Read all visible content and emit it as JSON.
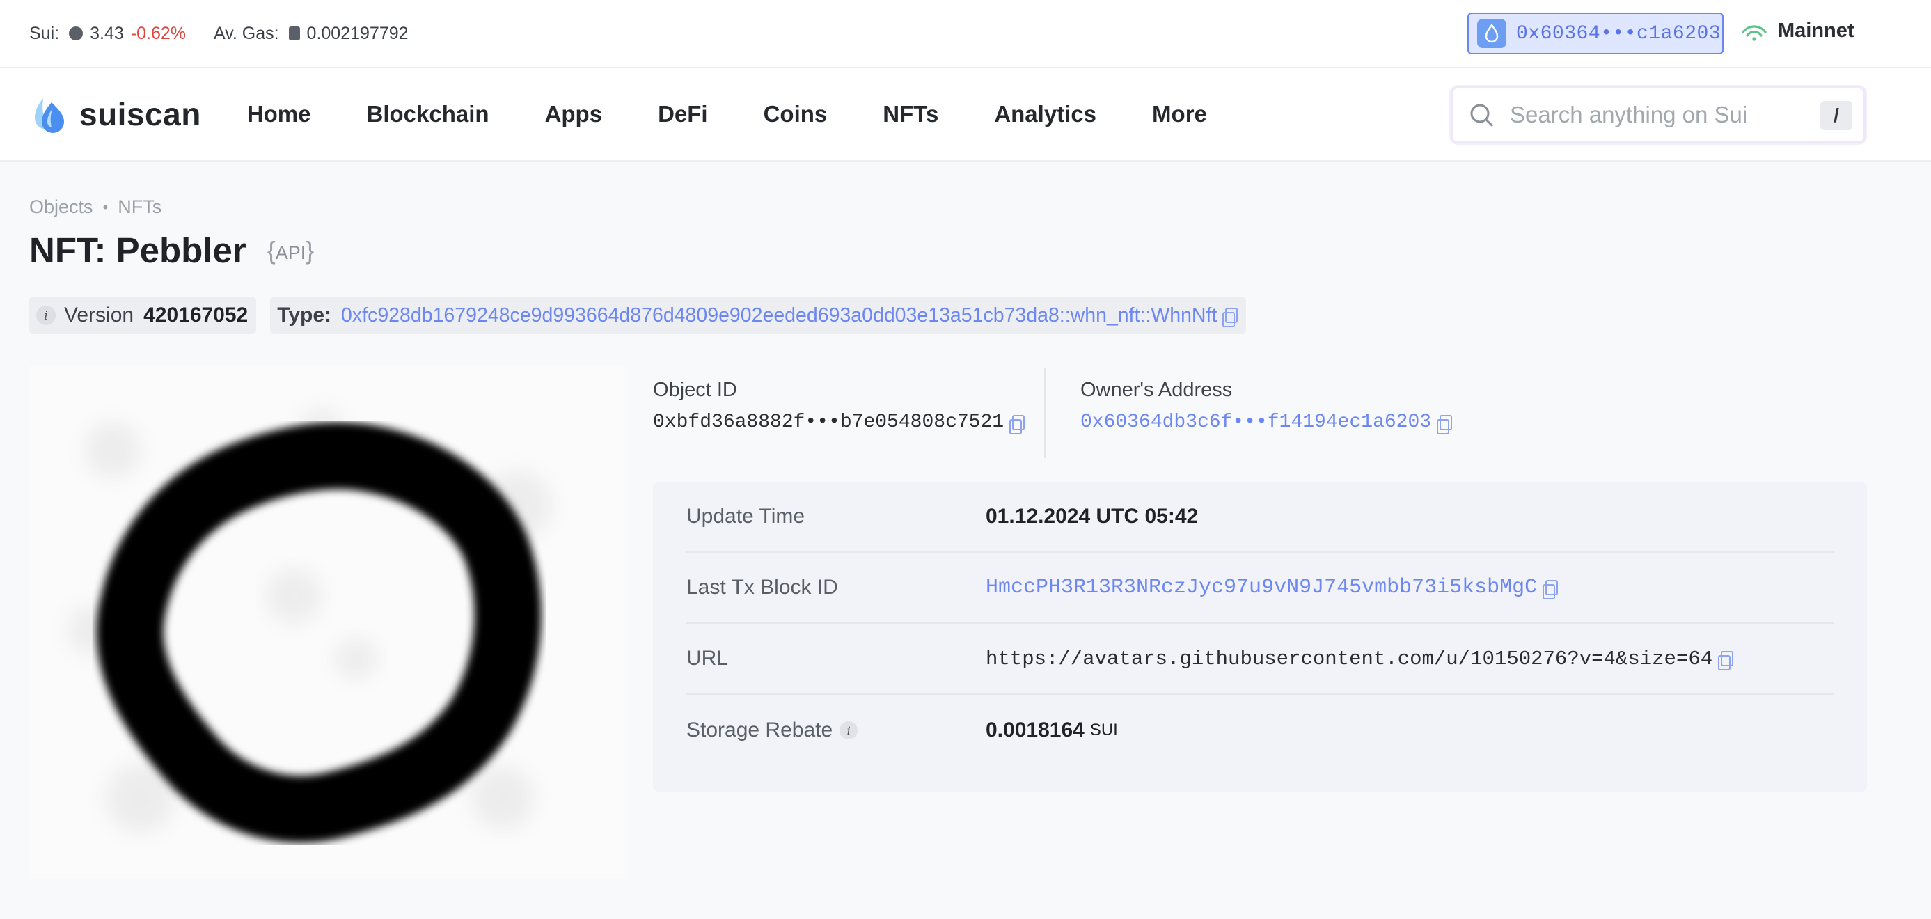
{
  "ticker": {
    "sui_label": "Sui:",
    "sui_price": "3.43",
    "sui_change": "-0.62%",
    "gas_label": "Av. Gas:",
    "gas_value": "0.002197792"
  },
  "wallet": {
    "address": "0x60364•••c1a6203"
  },
  "network": {
    "label": "Mainnet"
  },
  "brand": {
    "name": "suiscan"
  },
  "nav": {
    "items": [
      "Home",
      "Blockchain",
      "Apps",
      "DeFi",
      "Coins",
      "NFTs",
      "Analytics",
      "More"
    ]
  },
  "search": {
    "placeholder": "Search anything on Sui",
    "shortcut": "/"
  },
  "breadcrumb": [
    "Objects",
    "NFTs"
  ],
  "page": {
    "title": "NFT: Pebbler",
    "api_label": "API"
  },
  "meta": {
    "version_label": "Version",
    "version_value": "420167052",
    "type_label": "Type:",
    "type_value": "0xfc928db1679248ce9d993664d876d4809e902eeded693a0dd03e13a51cb73da8::whn_nft::WhnNft"
  },
  "object": {
    "id_label": "Object ID",
    "id_value": "0xbfd36a8882f•••b7e054808c7521",
    "owner_label": "Owner's Address",
    "owner_value": "0x60364db3c6f•••f14194ec1a6203"
  },
  "details": [
    {
      "label": "Update Time",
      "value": "01.12.2024 UTC 05:42"
    },
    {
      "label": "Last Tx Block ID",
      "value": "HmccPH3R13R3NRczJyc97u9vN9J745vmbb73i5ksbMgC"
    },
    {
      "label": "URL",
      "value": "https://avatars.githubusercontent.com/u/10150276?v=4&size=64"
    },
    {
      "label": "Storage Rebate",
      "value": "0.0018164",
      "unit": "SUI"
    }
  ],
  "colors": {
    "accent": "#6d87f2",
    "negative": "#e0453e",
    "online": "#5cc489"
  },
  "icons": [
    "sui-coin-icon",
    "gas-pump-icon",
    "sui-drop-icon",
    "signal-icon",
    "search-icon",
    "copy-icon",
    "info-icon"
  ]
}
